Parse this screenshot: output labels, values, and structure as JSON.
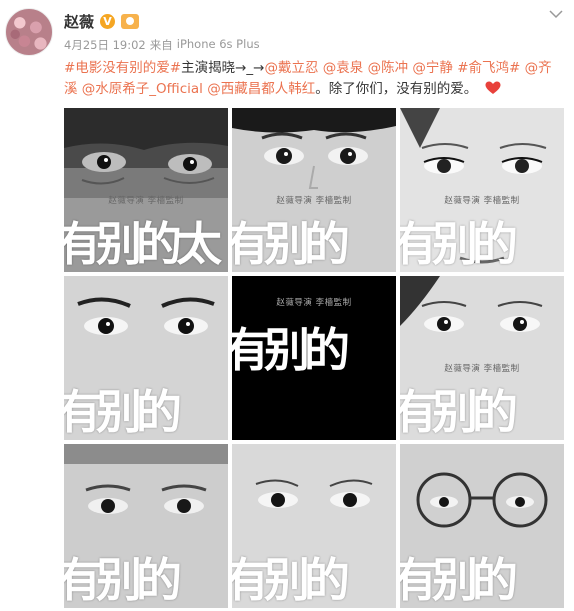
{
  "author": {
    "name": "赵薇",
    "verified_mark": "V"
  },
  "meta": {
    "date": "4月25日 19:02",
    "source_prefix": "来自",
    "device": "iPhone 6s Plus"
  },
  "post": {
    "hashtag_movie": "#电影没有别的爱#",
    "text_reveal": "主演揭晓→_→",
    "mentions_line1": [
      "@戴立忍",
      "@袁泉",
      "@陈冲",
      "@宁静"
    ],
    "hashtag_actor": "#俞飞鸿#",
    "mention_qi_part1": "@齐",
    "mention_qi_part2": "溪",
    "mentions_line2": [
      "@水原希子_Official",
      "@西藏昌都人韩红"
    ],
    "closing_text": "。除了你们，没有别的爱。"
  },
  "tiles": [
    {
      "credit": "赵薇导演 李檣監制",
      "title": "有别的太"
    },
    {
      "credit": "赵薇导演 李檣監制",
      "title": "有别的"
    },
    {
      "credit": "赵薇导演 李檣監制",
      "title": "有别的"
    },
    {
      "credit": "",
      "title": "有别的"
    },
    {
      "credit": "赵薇导演 李檣監制",
      "title": "有别的"
    },
    {
      "credit": "赵薇导演 李檣監制",
      "title": "有别的"
    },
    {
      "credit": "",
      "title": "有别的"
    },
    {
      "credit": "",
      "title": "有别的"
    },
    {
      "credit": "",
      "title": "有别的"
    }
  ],
  "colors": {
    "link": "#eb7350",
    "meta": "#999999",
    "heart": "#e8413b"
  }
}
